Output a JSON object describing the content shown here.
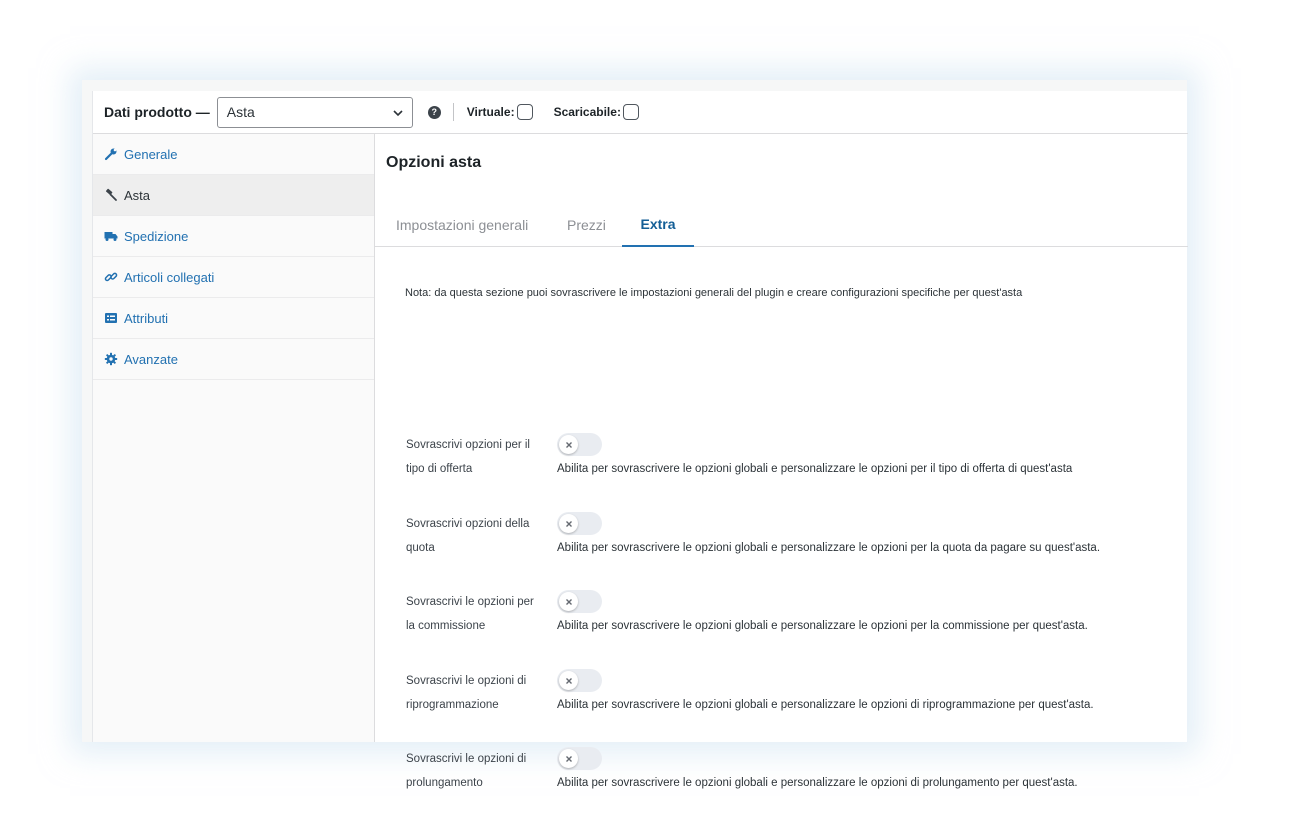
{
  "header": {
    "title": "Dati prodotto —",
    "product_type": "Asta",
    "virtual_label": "Virtuale:",
    "downloadable_label": "Scaricabile:"
  },
  "sidebar": {
    "items": [
      {
        "label": "Generale",
        "icon": "wrench-icon"
      },
      {
        "label": "Asta",
        "icon": "gavel-icon"
      },
      {
        "label": "Spedizione",
        "icon": "truck-icon"
      },
      {
        "label": "Articoli collegati",
        "icon": "link-icon"
      },
      {
        "label": "Attributi",
        "icon": "list-icon"
      },
      {
        "label": "Avanzate",
        "icon": "gear-icon"
      }
    ],
    "active_index": 1
  },
  "main": {
    "title": "Opzioni asta",
    "tabs": [
      {
        "label": "Impostazioni generali"
      },
      {
        "label": "Prezzi"
      },
      {
        "label": "Extra"
      }
    ],
    "active_tab": 2,
    "note": "Nota: da questa sezione puoi sovrascrivere le impostazioni generali del plugin e creare configurazioni specifiche per quest'asta",
    "options": [
      {
        "label_line1": "Sovrascrivi opzioni per il",
        "label_line2": "tipo di offerta",
        "description": "Abilita per sovrascrivere le opzioni globali e personalizzare le opzioni per il tipo di offerta di quest'asta",
        "enabled": false
      },
      {
        "label_line1": "Sovrascrivi opzioni della",
        "label_line2": "quota",
        "description": "Abilita per sovrascrivere le opzioni globali e personalizzare le opzioni per la quota da pagare su quest'asta.",
        "enabled": false
      },
      {
        "label_line1": "Sovrascrivi le opzioni per",
        "label_line2": "la commissione",
        "description": "Abilita per sovrascrivere le opzioni globali e personalizzare le opzioni per la commissione per quest'asta.",
        "enabled": false
      },
      {
        "label_line1": "Sovrascrivi le opzioni di",
        "label_line2": "riprogrammazione",
        "description": "Abilita per sovrascrivere le opzioni globali e personalizzare le opzioni di riprogrammazione per quest'asta.",
        "enabled": false
      },
      {
        "label_line1": "Sovrascrivi le opzioni di",
        "label_line2": "prolungamento",
        "description": "Abilita per sovrascrivere le opzioni globali e personalizzare le opzioni di prolungamento per quest'asta.",
        "enabled": false
      }
    ]
  },
  "colors": {
    "link": "#2271b1",
    "active_tab": "#135e96",
    "toggle_off": "#e9ecf1"
  }
}
